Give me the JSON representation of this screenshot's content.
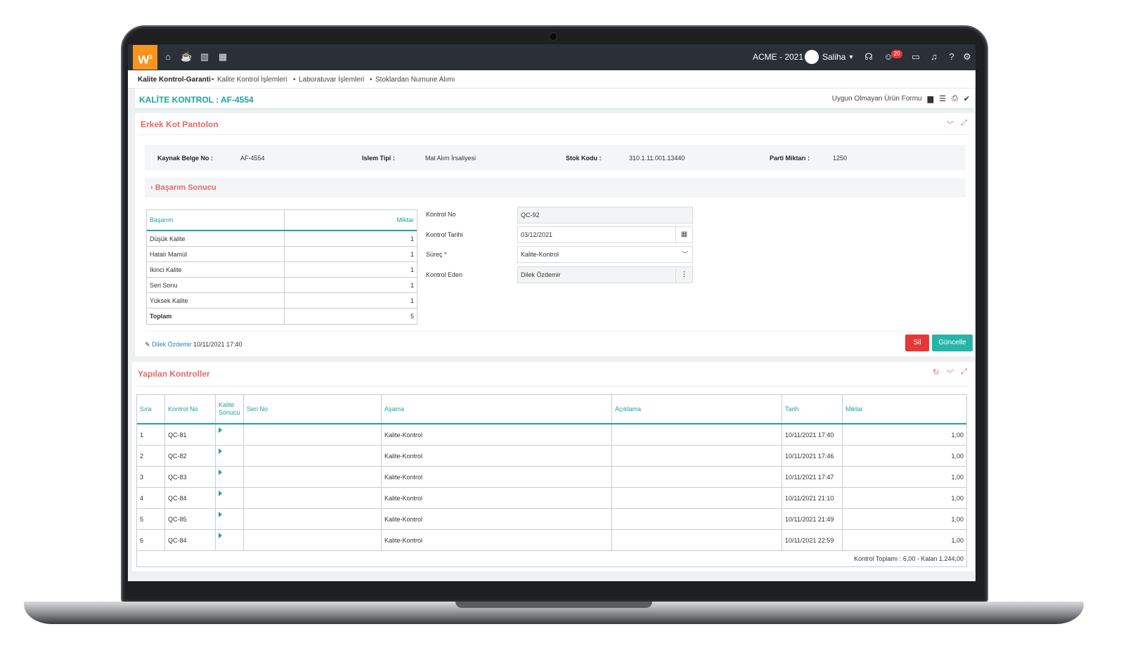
{
  "topbar": {
    "logo": "W",
    "logo_sup": "3",
    "company": "ACME - 2021",
    "user": "Saliha",
    "notification_count": "20"
  },
  "breadcrumb": [
    "Kalite Kontrol-Garanti",
    "Kalite Kontrol İşlemleri",
    "Laboratuvar İşlemleri",
    "Stoklardan Numune Alımı"
  ],
  "title": {
    "text": "KALİTE KONTROL : AF-4554",
    "action_label": "Uygun Olmayan Ürün Formu"
  },
  "panel1": {
    "title": "Erkek Kot Pantolon",
    "info": {
      "kaynak_label": "Kaynak Belge No :",
      "kaynak_value": "AF-4554",
      "islem_label": "Islem Tipi :",
      "islem_value": "Mal Alım İrsaliyesi",
      "stok_label": "Stok Kodu :",
      "stok_value": "310.1.11.001.13440",
      "parti_label": "Parti Miktarı :",
      "parti_value": "1250"
    },
    "section_title": "Başarım Sonucu",
    "basarim_table": {
      "headers": [
        "Başarım",
        "Miktar"
      ],
      "rows": [
        {
          "name": "Düşük Kalite",
          "qty": "1"
        },
        {
          "name": "Hatalı Mamül",
          "qty": "1"
        },
        {
          "name": "İkinci Kalite",
          "qty": "1"
        },
        {
          "name": "Seri Sonu",
          "qty": "1"
        },
        {
          "name": "Yüksek Kalite",
          "qty": "1"
        },
        {
          "name": "Toplam",
          "qty": "5"
        }
      ]
    },
    "form": {
      "kontrol_no_label": "Kontrol No",
      "kontrol_no_value": "QC-92",
      "kontrol_tarihi_label": "Kontrol Tarihi",
      "kontrol_tarihi_value": "03/12/2021",
      "surec_label": "Süreç *",
      "surec_value": "Kalite-Kontrol",
      "kontrol_eden_label": "Kontrol Eden",
      "kontrol_eden_value": "Dilek Özdemir"
    },
    "editor_user": "Dilek Özdemir",
    "editor_date": "10/11/2021 17:40",
    "delete_label": "Sil",
    "update_label": "Güncelle"
  },
  "panel2": {
    "title": "Yapılan Kontroller",
    "headers": [
      "Sıra",
      "Kontrol No",
      "Kalite Sonucu",
      "Seri No",
      "Aşama",
      "Açıklama",
      "Tarih",
      "Miktar"
    ],
    "rows": [
      {
        "sira": "1",
        "no": "QC-81",
        "seri": "",
        "asama": "Kalite-Kontrol",
        "aciklama": "",
        "tarih": "10/11/2021 17:40",
        "miktar": "1,00"
      },
      {
        "sira": "2",
        "no": "QC-82",
        "seri": "",
        "asama": "Kalite-Kontrol",
        "aciklama": "",
        "tarih": "10/11/2021 17:46",
        "miktar": "1,00"
      },
      {
        "sira": "3",
        "no": "QC-83",
        "seri": "",
        "asama": "Kalite-Kontrol",
        "aciklama": "",
        "tarih": "10/11/2021 17:47",
        "miktar": "1,00"
      },
      {
        "sira": "4",
        "no": "QC-84",
        "seri": "",
        "asama": "Kalite-Kontrol",
        "aciklama": "",
        "tarih": "10/11/2021 21:10",
        "miktar": "1,00"
      },
      {
        "sira": "5",
        "no": "QC-85",
        "seri": "",
        "asama": "Kalite-Kontrol",
        "aciklama": "",
        "tarih": "10/11/2021 21:49",
        "miktar": "1,00"
      },
      {
        "sira": "6",
        "no": "QC-84",
        "seri": "",
        "asama": "Kalite-Kontrol",
        "aciklama": "",
        "tarih": "10/11/2021 22:59",
        "miktar": "1,00"
      }
    ],
    "footer": "Kontrol Toplamı : 6,00 - Kalan 1.244,00"
  },
  "colors": {
    "accent": "#1fa3a0",
    "panel_title": "#e16b67",
    "logo": "#f7941d",
    "delete": "#e53935",
    "update": "#26b5a8",
    "topbar": "#2b3037"
  }
}
